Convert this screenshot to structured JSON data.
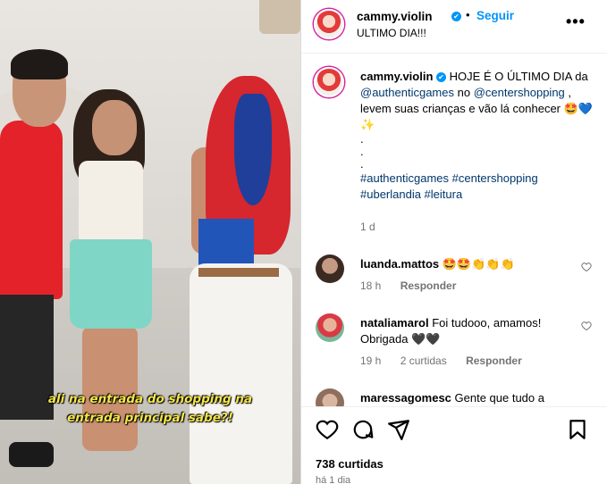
{
  "post": {
    "username": "cammy.violin",
    "verified_mark": "✔",
    "dot": "•",
    "follow_label": "Seguir",
    "subtitle": "ULTIMO DIA!!!",
    "more_icon": "•••",
    "caption_username": "cammy.violin",
    "caption_line1": " HOJE É O ÚLTIMO DIA da ",
    "caption_mention1": "@authenticgames",
    "caption_mid": " no ",
    "caption_mention2": "@centershopping",
    "caption_line2": ", levem suas crianças e vão lá conhecer 🤩💙✨",
    "caption_dots": ". . .",
    "hashtags": "#authenticgames #centershopping #uberlandia #leitura",
    "time": "1 d"
  },
  "video_caption": {
    "line1": "ali na entrada do shopping na",
    "line2": "entrada principal sabe?!"
  },
  "comments": [
    {
      "username": "luanda.mattos",
      "text": " 🤩🤩👏👏👏",
      "time": "18 h",
      "likes": "",
      "reply": "Responder"
    },
    {
      "username": "nataliamarol",
      "text": " Foi tudooo, amamos! Obrigada 🖤🖤",
      "time": "19 h",
      "likes": "2 curtidas",
      "reply": "Responder"
    },
    {
      "username": "maressagomesc",
      "text": " Gente que tudo a",
      "time": "",
      "likes": "",
      "reply": ""
    }
  ],
  "footer": {
    "likes": "738 curtidas",
    "ago": "há 1 dia"
  },
  "colors": {
    "accent": "#0095f6",
    "link": "#00376b",
    "muted": "#737373",
    "video_caption": "#f4e64a"
  }
}
